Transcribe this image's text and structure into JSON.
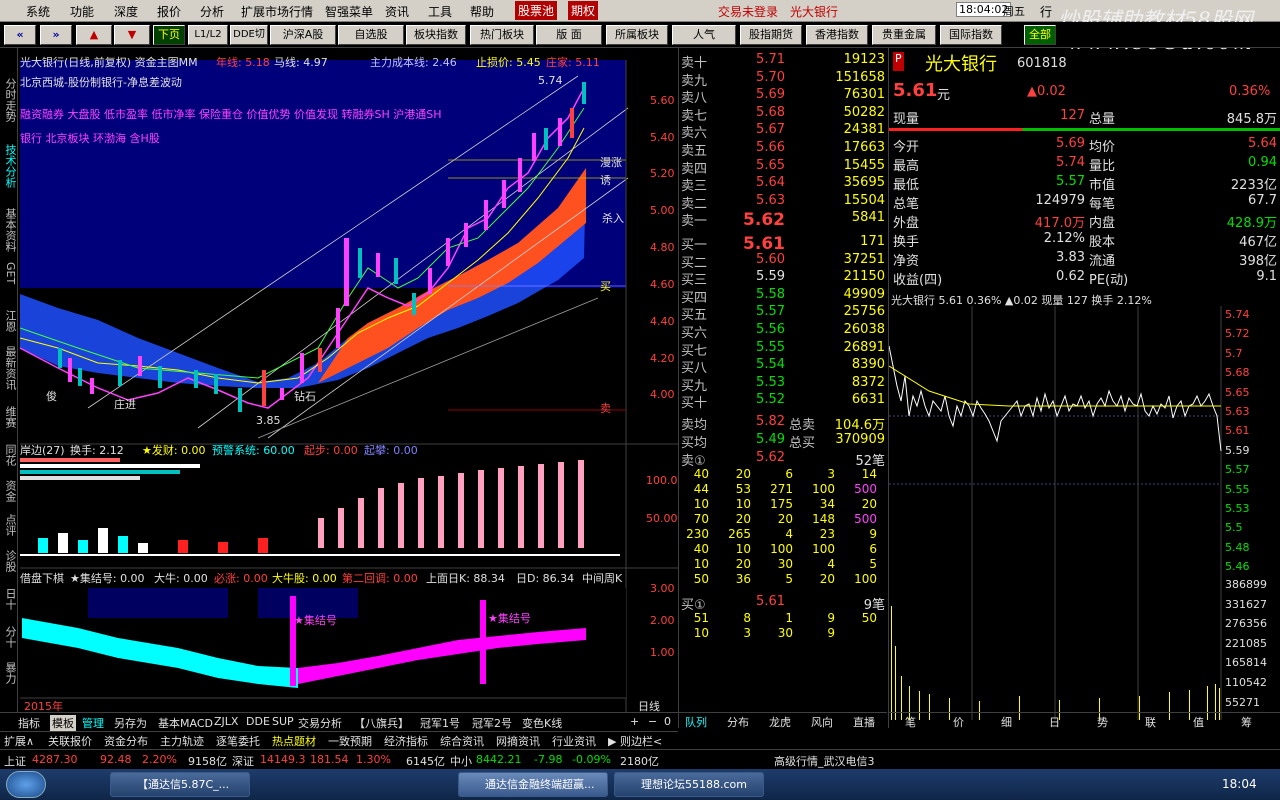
{
  "menu": {
    "items": [
      "系统",
      "功能",
      "深度",
      "报价",
      "分析",
      "扩展市场行情",
      "智强菜单",
      "资讯",
      "工具",
      "帮助"
    ],
    "hl1": "股票池",
    "hl2": "期权",
    "marquee1": "交易未登录",
    "marquee2": "光大银行",
    "clock": "18:04:02",
    "weekday": "周五",
    "more": "行"
  },
  "watermark": {
    "line1": "炒股辅助教材58股网",
    "line2": "www.58Gu.com"
  },
  "toolbar": {
    "buttons": [
      "下页",
      "L1/L2",
      "DDE切",
      "沪深A股",
      "自选股",
      "板块指数",
      "热门板块",
      "版 面",
      "所属板块",
      "人气",
      "股指期货",
      "香港指数",
      "贵重金属",
      "国际指数",
      "全部"
    ]
  },
  "leftside": {
    "items": [
      "分时走势",
      "技术分析",
      "基本资料",
      "GET",
      "江恩",
      "最新资讯",
      "维赛",
      "同花",
      "资金",
      "点评",
      "诊股",
      "日十",
      "分十",
      "暴力"
    ]
  },
  "chart": {
    "title": "光大银行(日线,前复权) 资金主图MM",
    "ma_year": "年线: 5.18",
    "ma_horse": "马线: 4.97",
    "cost": "主力成本线: 2.46",
    "stop": "止损价: 5.45",
    "zhu": "庄家: 5.11",
    "sub1": "北京西城-股份制银行-净息差波动",
    "concepts1": "融资融券 大盘股 低市盈率 低市净率 保险重仓 价值优势 价值发现 转融券SH 沪港通SH",
    "concepts2": "银行 北京板块 环渤海 含H股",
    "price_labels": [
      "5.60",
      "5.40",
      "5.20",
      "5.00",
      "4.80",
      "4.60",
      "4.40",
      "4.20",
      "4.00"
    ],
    "high_label": "5.74",
    "low_label": "3.85",
    "annot": [
      "庄进",
      "钻石",
      "俊",
      "杀入",
      "买",
      "卖",
      "诱",
      "漫涨"
    ],
    "ind1": {
      "name": "岸边(27)",
      "hs": "换手: 2.12",
      "fc": "★发财: 0.00",
      "yj": "预警系统: 60.00",
      "qb": "起步: 0.00",
      "qf": "起攀: 0.00",
      "l1": "100.0",
      "l2": "50.00"
    },
    "ind2": {
      "name": "借盘下棋",
      "jj": "★集结号: 0.00",
      "dn": "大牛: 0.00",
      "bz": "必涨: 0.00",
      "dnb": "大牛股: 0.00",
      "d2": "第二回调: 0.00",
      "sm": "上面日K: 88.34",
      "rd": "日D: 86.34",
      "zj": "中间周K",
      "l1": "3.00",
      "l2": "2.00",
      "l3": "1.00",
      "mark": "★集结号",
      "mark2": "★集结号"
    },
    "year": "2015年",
    "period": "日线"
  },
  "chart_data": [
    {
      "type": "candlestick",
      "title": "光大银行(日线,前复权) 资金主图MM",
      "ylim": [
        3.8,
        5.8
      ],
      "yticks": [
        5.6,
        5.4,
        5.2,
        5.0,
        4.8,
        4.6,
        4.4,
        4.2,
        4.0
      ],
      "high": 5.74,
      "low": 3.85
    },
    {
      "type": "line",
      "title": "光大银行",
      "ylim": [
        5.38,
        5.8
      ],
      "yticks": [
        5.74,
        5.72,
        5.7,
        5.68,
        5.65,
        5.63,
        5.61,
        5.59,
        5.57,
        5.55,
        5.53,
        5.5,
        5.48,
        5.46
      ],
      "vol_ticks": [
        386899,
        331627,
        276356,
        221085,
        165814,
        110542,
        55271
      ]
    }
  ],
  "orderbook": {
    "sell": [
      [
        "卖十",
        "5.71",
        "19123"
      ],
      [
        "卖九",
        "5.70",
        "151658"
      ],
      [
        "卖八",
        "5.69",
        "76301"
      ],
      [
        "卖七",
        "5.68",
        "50282"
      ],
      [
        "卖六",
        "5.67",
        "24381"
      ],
      [
        "卖五",
        "5.66",
        "17663"
      ],
      [
        "卖四",
        "5.65",
        "15455"
      ],
      [
        "卖三",
        "5.64",
        "35695"
      ],
      [
        "卖二",
        "5.63",
        "15504"
      ],
      [
        "卖一",
        "5.62",
        "5841"
      ]
    ],
    "buy": [
      [
        "买一",
        "5.61",
        "171"
      ],
      [
        "买二",
        "5.60",
        "37251"
      ],
      [
        "买三",
        "5.59",
        "21150"
      ],
      [
        "买四",
        "5.58",
        "49909"
      ],
      [
        "买五",
        "5.57",
        "25756"
      ],
      [
        "买六",
        "5.56",
        "26038"
      ],
      [
        "买七",
        "5.55",
        "26891"
      ],
      [
        "买八",
        "5.54",
        "8390"
      ],
      [
        "买九",
        "5.53",
        "8372"
      ],
      [
        "买十",
        "5.52",
        "6631"
      ]
    ],
    "avg_sell": [
      "卖均",
      "5.82",
      "总卖",
      "104.6万"
    ],
    "avg_buy": [
      "买均",
      "5.49",
      "总买",
      "370909"
    ],
    "q1": {
      "label": "卖①",
      "price": "5.62",
      "count": "52笔",
      "rows": [
        [
          "40",
          "20",
          "6",
          "3",
          "14"
        ],
        [
          "44",
          "53",
          "271",
          "100",
          "500"
        ],
        [
          "10",
          "10",
          "175",
          "34",
          "20"
        ],
        [
          "70",
          "20",
          "20",
          "148",
          "500"
        ],
        [
          "230",
          "265",
          "4",
          "23",
          "9"
        ],
        [
          "40",
          "10",
          "100",
          "100",
          "6"
        ],
        [
          "10",
          "20",
          "30",
          "4",
          "5"
        ],
        [
          "50",
          "36",
          "5",
          "20",
          "100"
        ]
      ]
    },
    "q2": {
      "label": "买①",
      "price": "5.61",
      "count": "9笔",
      "rows": [
        [
          "51",
          "8",
          "1",
          "9",
          "50"
        ],
        [
          "10",
          "3",
          "30",
          "9",
          ""
        ]
      ]
    },
    "tabs": [
      "队列",
      "分布",
      "龙虎",
      "风向",
      "直播"
    ]
  },
  "quote": {
    "name": "光大银行",
    "code": "601818",
    "tag": "P",
    "price": "5.61",
    "unit": "元",
    "chg": "▲0.02",
    "pct": "0.36%",
    "rows": [
      [
        "现量",
        "127",
        "总量",
        "845.8万"
      ],
      [
        "今开",
        "5.69",
        "均价",
        "5.64"
      ],
      [
        "最高",
        "5.74",
        "量比",
        "0.94"
      ],
      [
        "最低",
        "5.57",
        "市值",
        "2233亿"
      ],
      [
        "总笔",
        "124979",
        "每笔",
        "67.7"
      ],
      [
        "外盘",
        "417.0万",
        "内盘",
        "428.9万"
      ],
      [
        "换手",
        "2.12%",
        "股本",
        "467亿"
      ],
      [
        "净资",
        "3.83",
        "流通",
        "398亿"
      ],
      [
        "收益(四)",
        "0.62",
        "PE(动)",
        "9.1"
      ]
    ],
    "mini": "光大银行  5.61  0.36%  ▲0.02  现量 127  换手 2.12%",
    "tabs": [
      "笔",
      "价",
      "细",
      "日",
      "势",
      "联",
      "值",
      "筹"
    ]
  },
  "bottomtabs": {
    "row1": [
      "指标",
      "模板",
      "管理",
      "另存为",
      "基本MACD",
      "ZJLX",
      "DDE",
      "SUP",
      "交易分析",
      "【八旗兵】",
      "冠军1号",
      "冠军2号",
      "变色K线"
    ],
    "row2": [
      "扩展∧",
      "关联报价",
      "资金分布",
      "主力轨迹",
      "逐笔委托",
      "热点题材",
      "一致预期",
      "经济指标",
      "综合资讯",
      "网摘资讯",
      "行业资讯",
      "▶ 则边栏<"
    ]
  },
  "status": {
    "sh": "上证",
    "sh_v": "4287.30",
    "sh_c": "92.48",
    "sh_p": "2.20%",
    "sh_a": "9158亿",
    "sz": "深证",
    "sz_v": "14149.3",
    "sz_c": "181.54",
    "sz_p": "1.30%",
    "sz_a": "6145亿",
    "zx": "中小",
    "zx_v": "8442.21",
    "zx_c": "-7.98",
    "zx_p": "-0.09%",
    "zx_a": "2180亿",
    "server": "高级行情_武汉电信3"
  },
  "taskbar": {
    "items": [
      "【通达信5.87C_...",
      "通达信金融终端超赢...",
      "理想论坛55188.com"
    ],
    "time": "18:04"
  }
}
